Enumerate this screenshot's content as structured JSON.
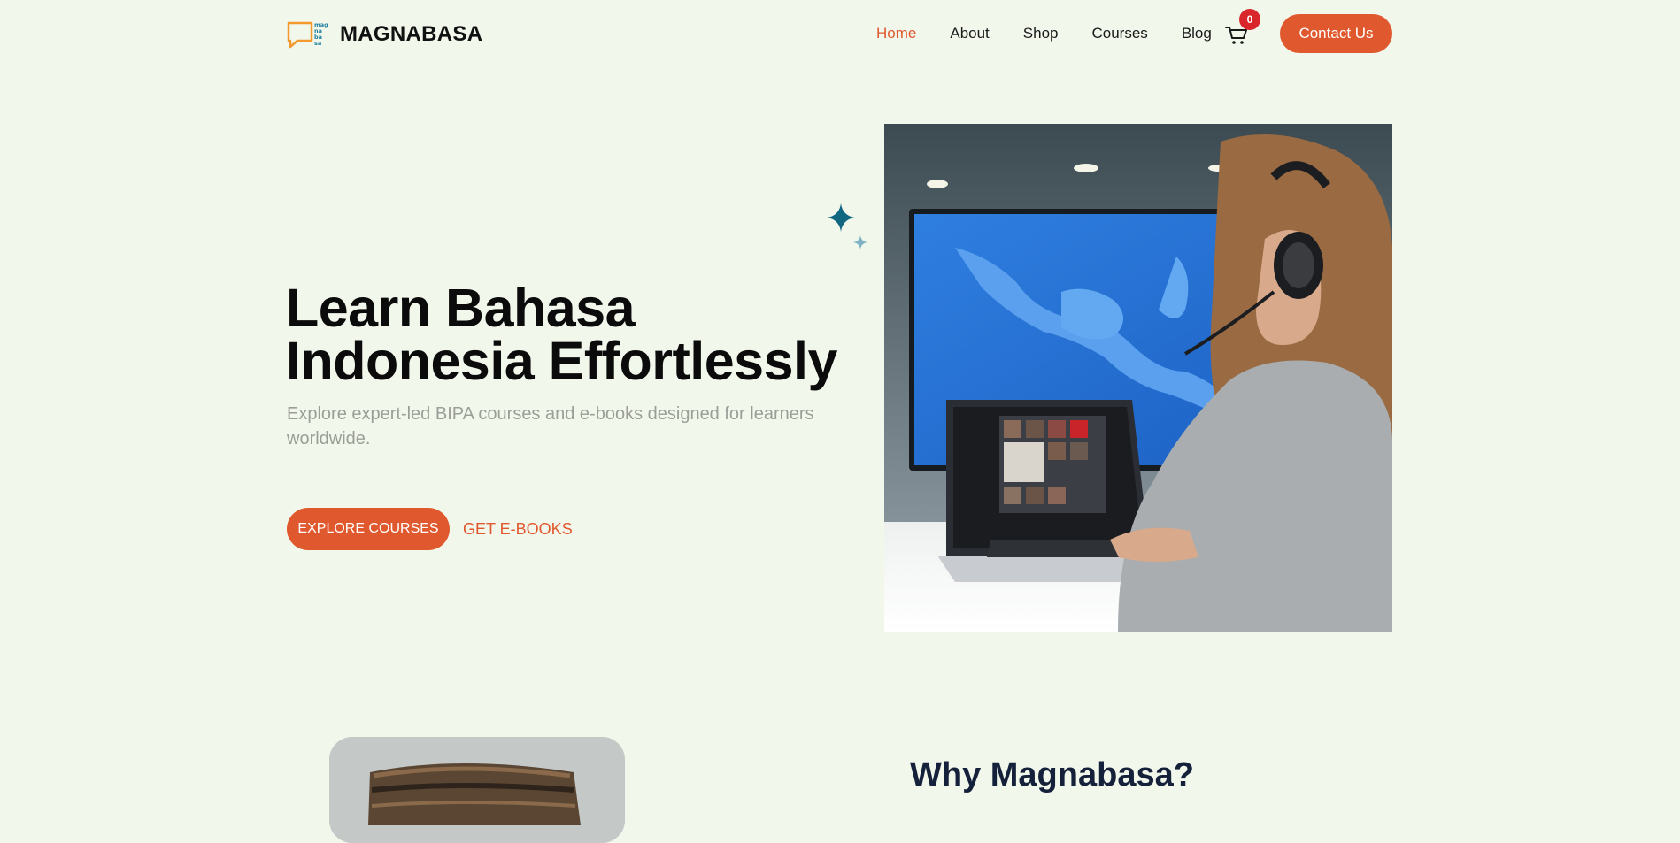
{
  "header": {
    "logo_text": "MAGNABASA",
    "logo_mark_text": [
      "mag",
      "na",
      "ba",
      "sa"
    ],
    "nav": [
      {
        "label": "Home",
        "active": true
      },
      {
        "label": "About",
        "active": false
      },
      {
        "label": "Shop",
        "active": false
      },
      {
        "label": "Courses",
        "active": false
      },
      {
        "label": "Blog",
        "active": false
      }
    ],
    "cart_count": "0",
    "contact_label": "Contact Us"
  },
  "hero": {
    "title_line1": "Learn Bahasa",
    "title_line2": "Indonesia Effortlessly",
    "subtitle": "Explore expert-led BIPA courses and e-books designed for learners worldwide.",
    "primary_cta": "EXPLORE COURSES",
    "secondary_cta": "GET E-BOOKS"
  },
  "why": {
    "title": "Why Magnabasa?"
  },
  "colors": {
    "accent": "#e0582e",
    "background": "#f2f7ec",
    "badge": "#d9262a",
    "sparkle": "#0f6781"
  },
  "icons": [
    "chat-bubble-logo-icon",
    "cart-icon",
    "sparkle-icon"
  ]
}
